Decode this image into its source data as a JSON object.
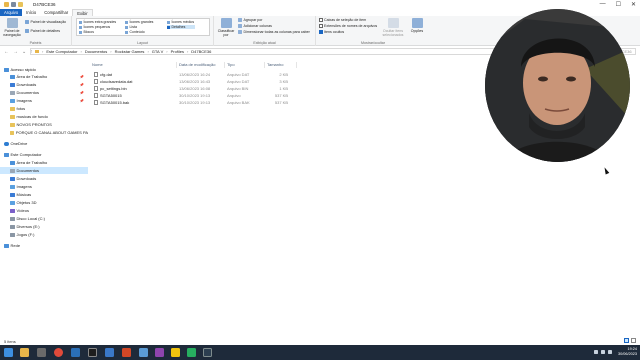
{
  "window": {
    "title": "D47BCE36",
    "controls": [
      "—",
      "☐",
      "✕"
    ]
  },
  "ribbon_tabs": [
    "Arquivo",
    "Início",
    "Compartilhar",
    "Exibir"
  ],
  "ribbon": {
    "panes": {
      "label": "Painéis",
      "nav_pane": "Painel de navegação",
      "preview_pane": "Painel de visualização",
      "details_pane": "Painel de detalhes"
    },
    "layout": {
      "label": "Layout",
      "options": [
        "Ícones extra grandes",
        "Ícones grandes",
        "Ícones médios",
        "Ícones pequenos",
        "Lista",
        "Detalhes",
        "Blocos",
        "Conteúdo"
      ],
      "selected": "Detalhes"
    },
    "current_view": {
      "label": "Exibição atual",
      "sort_by": "Classificar por",
      "group_by": "Agrupar por",
      "add_columns": "Adicionar colunas",
      "size_columns": "Dimensionar todas as colunas para caber"
    },
    "show_hide": {
      "label": "Mostrar/ocultar",
      "item_checkboxes": "Caixas de seleção de item",
      "file_extensions": "Extensões de nomes de arquivos",
      "hidden_items": "Itens ocultos",
      "hide_selected": "Ocultar itens selecionados",
      "options": "Opções"
    }
  },
  "address": {
    "crumbs": [
      "Este Computador",
      "Documentos",
      "Rockstar Games",
      "GTA V",
      "Profiles",
      "D47BCE36"
    ],
    "search_placeholder": "Pesquisar em D47BCE36"
  },
  "nav_pane": {
    "items": [
      {
        "label": "Acesso rápido",
        "pinned": false,
        "level": 0
      },
      {
        "label": "Área de Trabalho",
        "pinned": true,
        "level": 1
      },
      {
        "label": "Downloads",
        "pinned": true,
        "level": 1
      },
      {
        "label": "Documentos",
        "pinned": true,
        "level": 1
      },
      {
        "label": "Imagens",
        "pinned": true,
        "level": 1
      },
      {
        "label": "fotos",
        "pinned": false,
        "level": 1
      },
      {
        "label": "musicas de fundo",
        "pinned": false,
        "level": 1
      },
      {
        "label": "NOVOS PRONTOS",
        "pinned": false,
        "level": 1
      },
      {
        "label": "PORQUE O CANAL ABOUT GAMES PA",
        "pinned": false,
        "level": 1
      },
      {
        "label": "OneDrive",
        "pinned": false,
        "level": 0
      },
      {
        "label": "Este Computador",
        "pinned": false,
        "level": 0
      },
      {
        "label": "Área de Trabalho",
        "pinned": false,
        "level": 1
      },
      {
        "label": "Documentos",
        "pinned": false,
        "level": 1
      },
      {
        "label": "Downloads",
        "pinned": false,
        "level": 1
      },
      {
        "label": "Imagens",
        "pinned": false,
        "level": 1
      },
      {
        "label": "Músicas",
        "pinned": false,
        "level": 1
      },
      {
        "label": "Objetos 3D",
        "pinned": false,
        "level": 1
      },
      {
        "label": "Vídeos",
        "pinned": false,
        "level": 1
      },
      {
        "label": "Disco Local (C:)",
        "pinned": false,
        "level": 1
      },
      {
        "label": "Diversos (E:)",
        "pinned": false,
        "level": 1
      },
      {
        "label": "Jogos (F:)",
        "pinned": false,
        "level": 1
      },
      {
        "label": "Rede",
        "pinned": false,
        "level": 0
      }
    ],
    "selected": "Documentos"
  },
  "columns": [
    "Nome",
    "Data de modificação",
    "Tipo",
    "Tamanho"
  ],
  "files": [
    {
      "name": "cfg.dat",
      "date": "13/06/2023 16:24",
      "type": "Arquivo DAT",
      "size": "2 KB"
    },
    {
      "name": "cloudsavedata.dat",
      "date": "13/06/2023 16:43",
      "type": "Arquivo DAT",
      "size": "3 KB"
    },
    {
      "name": "pc_settings.bin",
      "date": "13/06/2023 16:08",
      "type": "Arquivo BIN",
      "size": "1 KB"
    },
    {
      "name": "SGTA50015",
      "date": "30/10/2023 19:13",
      "type": "Arquivo",
      "size": "537 KB"
    },
    {
      "name": "SGTA50015.bak",
      "date": "30/10/2023 19:13",
      "type": "Arquivo BAK",
      "size": "537 KB"
    }
  ],
  "status": {
    "item_count": "5 itens"
  },
  "taskbar": {
    "time": "19:24",
    "date": "30/06/2023"
  },
  "colors": {
    "accent": "#1a66c2",
    "taskbar": "#1e2a3a",
    "selection": "#cce8ff"
  }
}
